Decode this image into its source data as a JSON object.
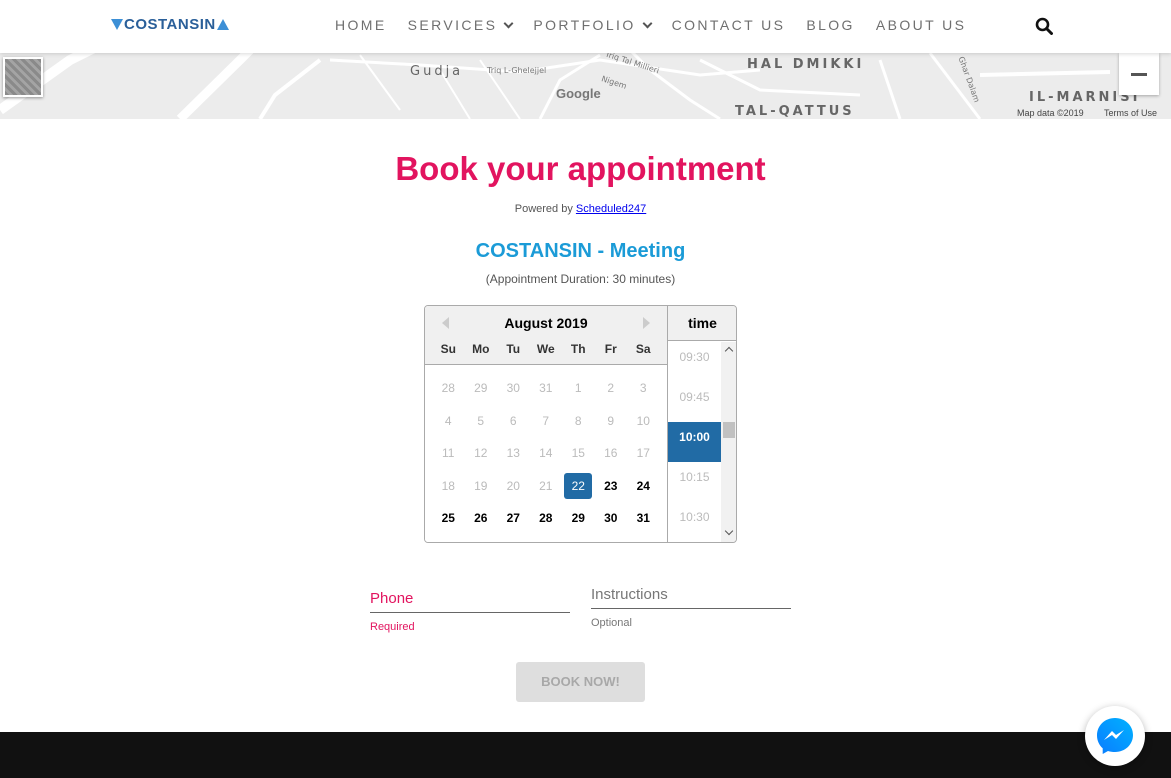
{
  "header": {
    "logo_text": "COSTANSIN",
    "nav": [
      {
        "label": "HOME",
        "has_dropdown": false
      },
      {
        "label": "SERVICES",
        "has_dropdown": true
      },
      {
        "label": "PORTFOLIO",
        "has_dropdown": true
      },
      {
        "label": "CONTACT US",
        "has_dropdown": false
      },
      {
        "label": "BLOG",
        "has_dropdown": false
      },
      {
        "label": "ABOUT US",
        "has_dropdown": false
      }
    ],
    "search_icon": "search-icon"
  },
  "map": {
    "labels": {
      "gudja": "Gudja",
      "hal_dmikki": "HAL DMIKKI",
      "tal_qattus": "TAL-QATTUS",
      "il_marnisi": "IL-MARNISI",
      "triq_ghelejjel": "Triq L-Ghelejjel",
      "triq_tal_millieri": "Triq Tal Millieri",
      "nigem": "Nigem",
      "ghar_dalam": "Ghar Dalam"
    },
    "google": "Google",
    "map_data": "Map data ©2019",
    "terms": "Terms of Use"
  },
  "booking": {
    "title": "Book your appointment",
    "powered_prefix": "Powered by ",
    "powered_link": "Scheduled247",
    "meeting_title": "COSTANSIN - Meeting",
    "duration": "(Appointment Duration: 30 minutes)"
  },
  "calendar": {
    "month": "August 2019",
    "weekdays": [
      "Su",
      "Mo",
      "Tu",
      "We",
      "Th",
      "Fr",
      "Sa"
    ],
    "weeks": [
      [
        {
          "d": "28",
          "s": "dis"
        },
        {
          "d": "29",
          "s": "dis"
        },
        {
          "d": "30",
          "s": "dis"
        },
        {
          "d": "31",
          "s": "dis"
        },
        {
          "d": "1",
          "s": "dis"
        },
        {
          "d": "2",
          "s": "dis"
        },
        {
          "d": "3",
          "s": "dis"
        }
      ],
      [
        {
          "d": "4",
          "s": "dis"
        },
        {
          "d": "5",
          "s": "dis"
        },
        {
          "d": "6",
          "s": "dis"
        },
        {
          "d": "7",
          "s": "dis"
        },
        {
          "d": "8",
          "s": "dis"
        },
        {
          "d": "9",
          "s": "dis"
        },
        {
          "d": "10",
          "s": "dis"
        }
      ],
      [
        {
          "d": "11",
          "s": "dis"
        },
        {
          "d": "12",
          "s": "dis"
        },
        {
          "d": "13",
          "s": "dis"
        },
        {
          "d": "14",
          "s": "dis"
        },
        {
          "d": "15",
          "s": "dis"
        },
        {
          "d": "16",
          "s": "dis"
        },
        {
          "d": "17",
          "s": "dis"
        }
      ],
      [
        {
          "d": "18",
          "s": "dis"
        },
        {
          "d": "19",
          "s": "dis"
        },
        {
          "d": "20",
          "s": "dis"
        },
        {
          "d": "21",
          "s": "dis"
        },
        {
          "d": "22",
          "s": "sel"
        },
        {
          "d": "23",
          "s": "avail"
        },
        {
          "d": "24",
          "s": "avail"
        }
      ],
      [
        {
          "d": "25",
          "s": "avail"
        },
        {
          "d": "26",
          "s": "avail"
        },
        {
          "d": "27",
          "s": "avail"
        },
        {
          "d": "28",
          "s": "avail"
        },
        {
          "d": "29",
          "s": "avail"
        },
        {
          "d": "30",
          "s": "avail"
        },
        {
          "d": "31",
          "s": "avail"
        }
      ]
    ],
    "time_header": "time",
    "times": [
      {
        "t": "09:30",
        "selected": false
      },
      {
        "t": "09:45",
        "selected": false
      },
      {
        "t": "10:00",
        "selected": true
      },
      {
        "t": "10:15",
        "selected": false
      },
      {
        "t": "10:30",
        "selected": false
      }
    ]
  },
  "form": {
    "phone_label": "Phone",
    "phone_hint": "Required",
    "instructions_label": "Instructions",
    "instructions_hint": "Optional",
    "submit": "BOOK NOW!"
  },
  "colors": {
    "accent_pink": "#e2145f",
    "accent_blue": "#1b9bd7",
    "selected_blue": "#216ba5"
  }
}
